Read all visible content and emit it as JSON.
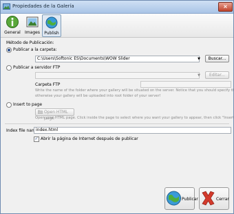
{
  "window": {
    "title": "Propiedades de la Galería",
    "close_symbol": "×"
  },
  "toolbar": {
    "general": "General",
    "images": "Images",
    "publish": "Publish"
  },
  "publication": {
    "method_label": "Método de Publicación:",
    "option_folder": "Publicar a la carpeta:",
    "folder_path": "C:\\Users\\Softonic ES\\Documents\\WOW Slider",
    "browse_button": "Buscar...",
    "option_ftp": "Publicar a servidor FTP",
    "ftp_edit_button": "Editar...",
    "ftp_folder_label": "Carpeta FTP",
    "ftp_desc_1": "Write the name of the folder where your gallery will be situated on the server. Notice that you should specify this field,",
    "ftp_desc_2": "otherwise your gallery will be uploaded into root folder of your server!",
    "option_insert": "Insert to page",
    "open_html_button": "Open HTML page",
    "insert_desc": "Open your HTML page. Click inside the page to select where you want your gallery to appear, then click \"Insert After\".",
    "index_label": "Index file name",
    "index_value": "index.html",
    "open_browser_label": "Abrir la página de Internet después de publicar",
    "open_browser_checked": "✓"
  },
  "footer": {
    "publish_button": "Publicar",
    "close_button": "Cerrar"
  },
  "colors": {
    "accent": "#2a4f8c",
    "close_red": "#c0432c"
  }
}
